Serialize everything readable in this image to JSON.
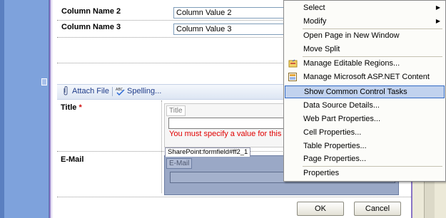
{
  "form": {
    "rows": [
      {
        "label": "Column Name 2",
        "value": "Column Value 2"
      },
      {
        "label": "Column Name 3",
        "value": "Column Value 3"
      }
    ],
    "toolbar": {
      "attach_label": "Attach File",
      "spelling_label": "Spelling..."
    },
    "title_field": {
      "label": "Title",
      "required_marker": "*",
      "caption": "Title",
      "error": "You must specify a value for this r"
    },
    "email_field": {
      "label": "E-Mail",
      "tag": "SharePoint:formfield#ff2_1",
      "caption": "E-Mail"
    },
    "buttons": {
      "ok": "OK",
      "cancel": "Cancel"
    }
  },
  "context_menu": {
    "items": [
      {
        "label": "Select",
        "has_submenu": true
      },
      {
        "label": "Modify",
        "has_submenu": true
      },
      {
        "label": "Open Page in New Window"
      },
      {
        "label": "Move Split"
      },
      {
        "label": "Manage Editable Regions...",
        "icon": "editable-regions-icon"
      },
      {
        "label": "Manage Microsoft ASP.NET Content Regions...",
        "icon": "content-regions-icon"
      },
      {
        "label": "Show Common Control Tasks",
        "highlighted": true
      },
      {
        "label": "Data Source Details..."
      },
      {
        "label": "Web Part Properties..."
      },
      {
        "label": "Cell Properties..."
      },
      {
        "label": "Table Properties..."
      },
      {
        "label": "Page Properties..."
      },
      {
        "label": "Properties"
      }
    ],
    "highlight_color": "#c1d2ee"
  }
}
